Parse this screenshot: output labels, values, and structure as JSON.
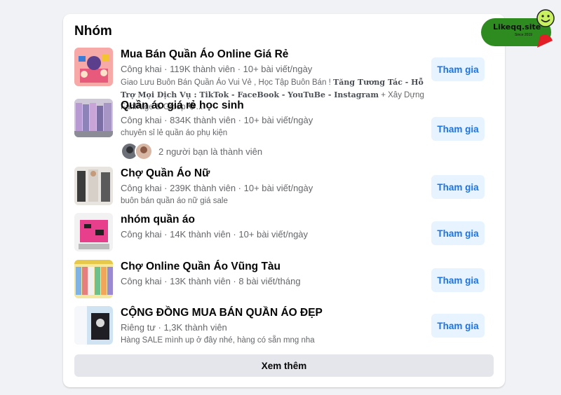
{
  "section": {
    "title": "Nhóm",
    "see_more": "Xem thêm"
  },
  "groups": [
    {
      "name": "Mua Bán Quần Áo Online Giá Rẻ",
      "meta": "Công khai · 119K thành viên · 10+ bài viết/ngày",
      "desc_plain": "Giao Lưu Buôn Bán Quần Áo Vui Vẻ , Học Tập Buôn Bán ! ",
      "desc_bold1": "Tăng Tương Tác - Hỗ Trợ Mọi Dịch Vụ : TikTok - FaceBook - YouTuBe - Instagram",
      "desc_tail": " + Xây Dựng FanPage & Group �...",
      "join": "Tham gia"
    },
    {
      "name": "Quần áo giá rẻ học sinh",
      "meta": "Công khai · 834K thành viên · 10+ bài viết/ngày",
      "desc": "chuyên sỉ lẻ quần áo phụ kiện",
      "friends": "2 người bạn là thành viên",
      "join": "Tham gia"
    },
    {
      "name": "Chợ Quần Áo Nữ",
      "meta": "Công khai · 239K thành viên · 10+ bài viết/ngày",
      "desc": "buôn bán quần áo nữ giá sale",
      "join": "Tham gia"
    },
    {
      "name": "nhóm quần áo",
      "meta": "Công khai · 14K thành viên · 10+ bài viết/ngày",
      "join": "Tham gia"
    },
    {
      "name": "Chợ Online Quần Áo Vũng Tàu",
      "meta": "Công khai · 13K thành viên · 8 bài viết/tháng",
      "join": "Tham gia"
    },
    {
      "name": "CỘNG ĐỒNG MUA BÁN QUẦN ÁO ĐẸP",
      "meta": "Riêng tư · 1,3K thành viên",
      "desc": "Hàng SALE mình up ở đây nhé, hàng có sẵn mng nha",
      "join": "Tham gia"
    }
  ],
  "watermark": {
    "text": "Likeqq.site",
    "sub": "Since 2019",
    "icon": "smiley-icon"
  },
  "colors": {
    "join_bg": "#e7f3ff",
    "join_text": "#1b74e4",
    "muted": "#65676b"
  }
}
